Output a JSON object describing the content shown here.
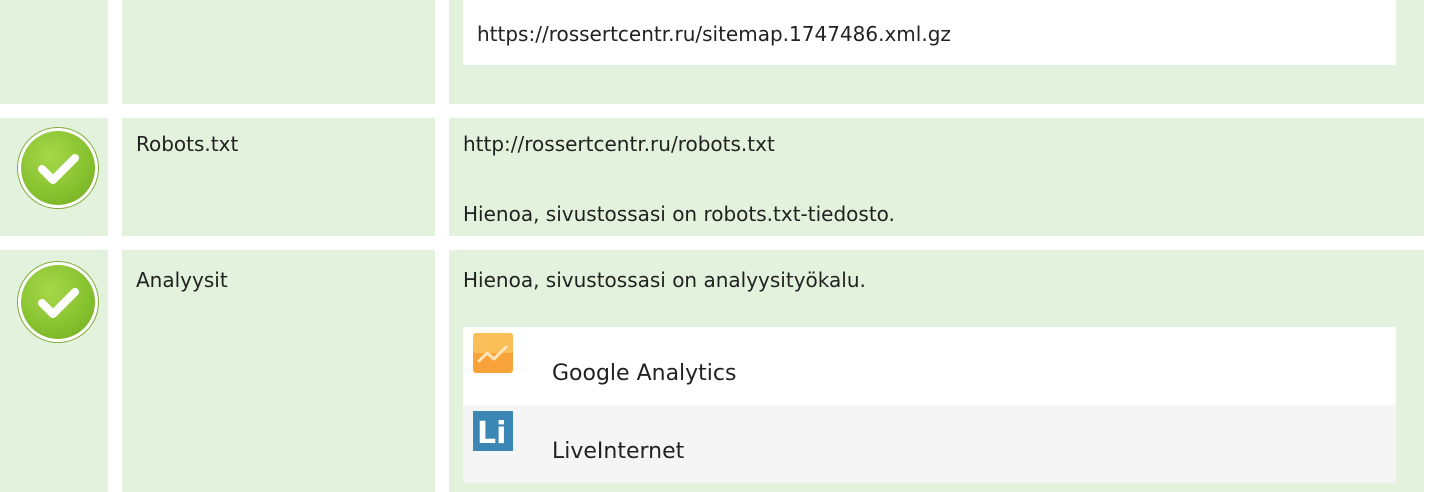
{
  "sitemap": {
    "url": "https://rossertcentr.ru/sitemap.1747486.xml.gz"
  },
  "rows": [
    {
      "label": "Robots.txt",
      "status_icon": "check-circle-icon",
      "url": "http://rossertcentr.ru/robots.txt",
      "message": "Hienoa, sivustossasi on robots.txt-tiedosto."
    },
    {
      "label": "Analyysit",
      "status_icon": "check-circle-icon",
      "message": "Hienoa, sivustossasi on analyysityökalu.",
      "tools": [
        {
          "name": "Google Analytics",
          "icon": "google-analytics-icon"
        },
        {
          "name": "LiveInternet",
          "icon": "liveinternet-icon"
        }
      ]
    }
  ],
  "colors": {
    "row_bg": "#e2f2dc",
    "check_green": "#86c12e",
    "ga_orange": "#f7a33a",
    "li_blue": "#3a86b4"
  }
}
